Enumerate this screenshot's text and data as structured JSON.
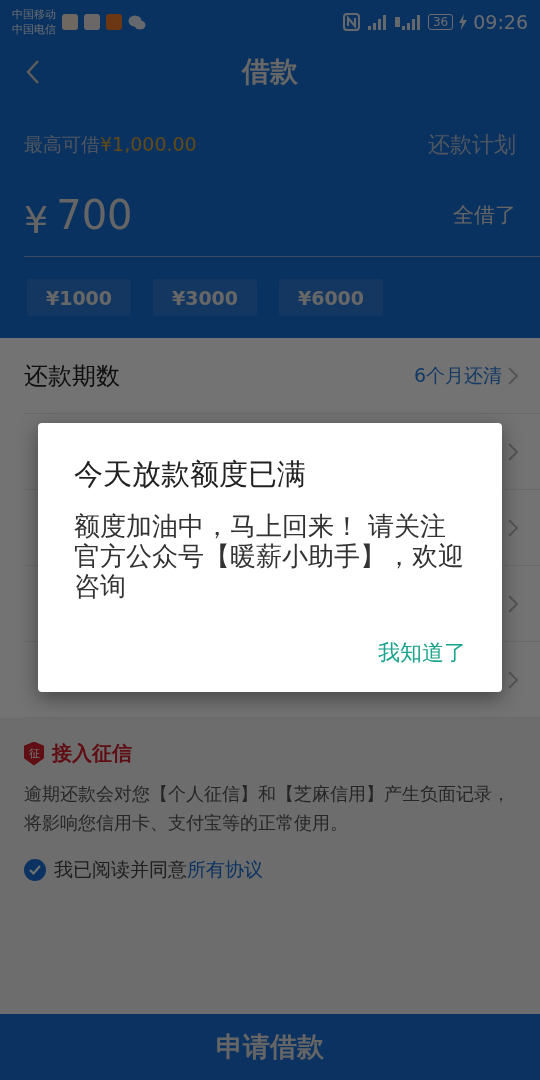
{
  "status_bar": {
    "carriers": [
      "中国移动",
      "中国电信"
    ],
    "battery": "36",
    "time": "09:26"
  },
  "nav": {
    "title": "借款"
  },
  "loan": {
    "max_label": "最高可借",
    "max_amount": "¥1,000.00",
    "plan_link": "还款计划",
    "currency": "¥",
    "amount": "700",
    "borrow_all": "全借了",
    "presets": [
      "¥1000",
      "¥3000",
      "¥6000"
    ]
  },
  "options": [
    {
      "kind": "shown",
      "label": "还款期数",
      "value": "6个月还清"
    },
    {
      "kind": "covered"
    },
    {
      "kind": "covered"
    },
    {
      "kind": "covered"
    },
    {
      "kind": "covered"
    }
  ],
  "credit": {
    "badge": "征",
    "title": "接入征信",
    "notice": "逾期还款会对您【个人征信】和【芝麻信用】产生负面记录，将影响您信用卡、支付宝等的正常使用。",
    "agree": {
      "checked": true,
      "text": "我已阅读并同意",
      "link": "所有协议"
    }
  },
  "submit": "申请借款",
  "dialog": {
    "title": "今天放款额度已满",
    "message": "额度加油中，马上回来！ 请关注官方公众号【暖薪小助手】，欢迎咨询",
    "button": "我知道了"
  }
}
